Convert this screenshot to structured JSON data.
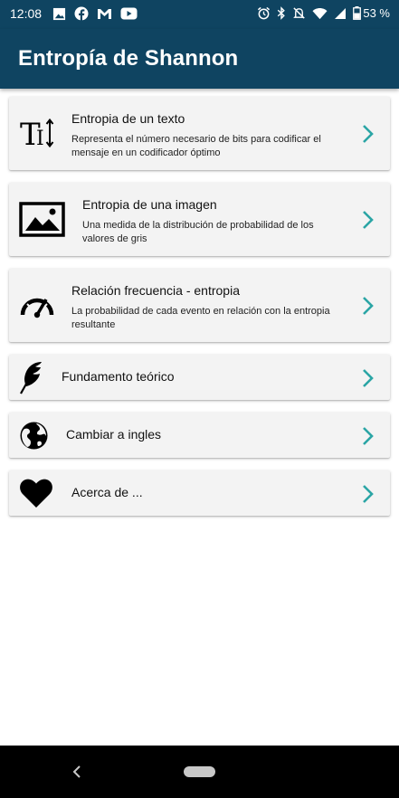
{
  "status_bar": {
    "time": "12:08",
    "battery": "53 %",
    "left_icons": [
      "image-icon",
      "facebook-icon",
      "gmail-icon",
      "youtube-icon"
    ],
    "right_icons": [
      "alarm-icon",
      "bluetooth-icon",
      "mute-icon",
      "wifi-icon",
      "signal-icon",
      "battery-icon"
    ]
  },
  "app_bar": {
    "title": "Entropía de Shannon",
    "background_color": "#0f4461"
  },
  "cards": [
    {
      "title": "Entropia de un texto",
      "description": "Representa el número necesario de bits para codificar el mensaje en un codificador óptimo",
      "icon": "text-size-icon"
    },
    {
      "title": "Entropia de una imagen",
      "description": "Una medida de la distribución de probabilidad de los valores de gris",
      "icon": "image-icon"
    },
    {
      "title": "Relación frecuencia - entropia",
      "description": "La probabilidad de cada evento en relación con la entropia resultante",
      "icon": "speedometer-icon"
    },
    {
      "title": "Fundamento teórico",
      "description": "",
      "icon": "feather-icon"
    },
    {
      "title": "Cambiar a ingles",
      "description": "",
      "icon": "globe-icon"
    },
    {
      "title": "Acerca de ...",
      "description": "",
      "icon": "heart-icon"
    }
  ],
  "accent_color": "#2aa5a5"
}
